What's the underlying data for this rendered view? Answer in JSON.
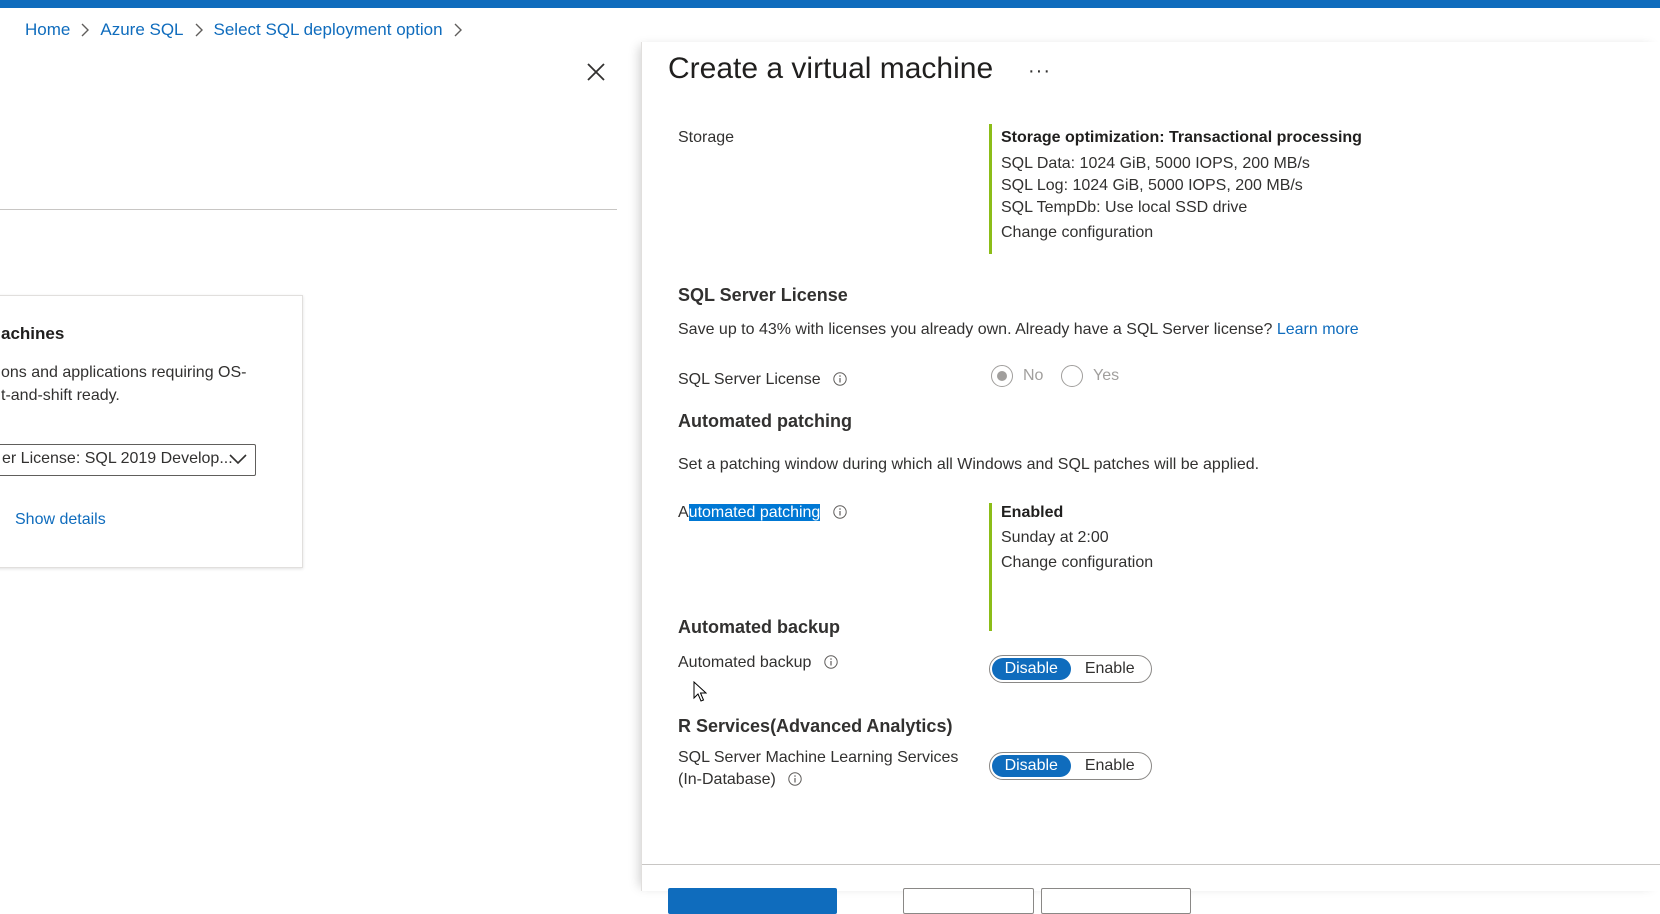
{
  "breadcrumb": {
    "items": [
      "Home",
      "Azure SQL",
      "Select SQL deployment option"
    ]
  },
  "left": {
    "card_title": "achines",
    "card_desc": "ons and applications requiring OS-\nt-and-shift ready.",
    "select_value": "er License: SQL 2019 Develop...",
    "show_details": "Show details"
  },
  "panel": {
    "title": "Create a virtual machine",
    "more": "···",
    "storage": {
      "label": "Storage",
      "heading": "Storage optimization: Transactional processing",
      "lines": [
        "SQL Data: 1024 GiB, 5000 IOPS, 200 MB/s",
        "SQL Log: 1024 GiB, 5000 IOPS, 200 MB/s",
        "SQL TempDb: Use local SSD drive"
      ],
      "change": "Change configuration"
    },
    "license": {
      "section": "SQL Server License",
      "desc": "Save up to 43% with licenses you already own. Already have a SQL Server license?",
      "learn_more": "Learn more",
      "label": "SQL Server License",
      "options": [
        "No",
        "Yes"
      ],
      "selected": "No"
    },
    "patching": {
      "section": "Automated patching",
      "desc": "Set a patching window during which all Windows and SQL patches will be applied.",
      "label_first": "A",
      "label_rest": "utomated patching",
      "status": "Enabled",
      "schedule": "Sunday at 2:00",
      "change": "Change configuration"
    },
    "backup": {
      "section": "Automated backup",
      "label": "Automated backup",
      "options": [
        "Disable",
        "Enable"
      ],
      "selected": "Disable"
    },
    "rservices": {
      "section": "R Services(Advanced Analytics)",
      "label_line1": "SQL Server Machine Learning Services",
      "label_line2": "(In-Database)",
      "options": [
        "Disable",
        "Enable"
      ],
      "selected": "Disable"
    }
  },
  "colors": {
    "accent": "#0f6cbd",
    "status_bar": "#8cbd18"
  },
  "icons": [
    "chevron-right-icon",
    "close-icon",
    "chevron-down-icon",
    "info-icon",
    "mouse-cursor-icon"
  ]
}
